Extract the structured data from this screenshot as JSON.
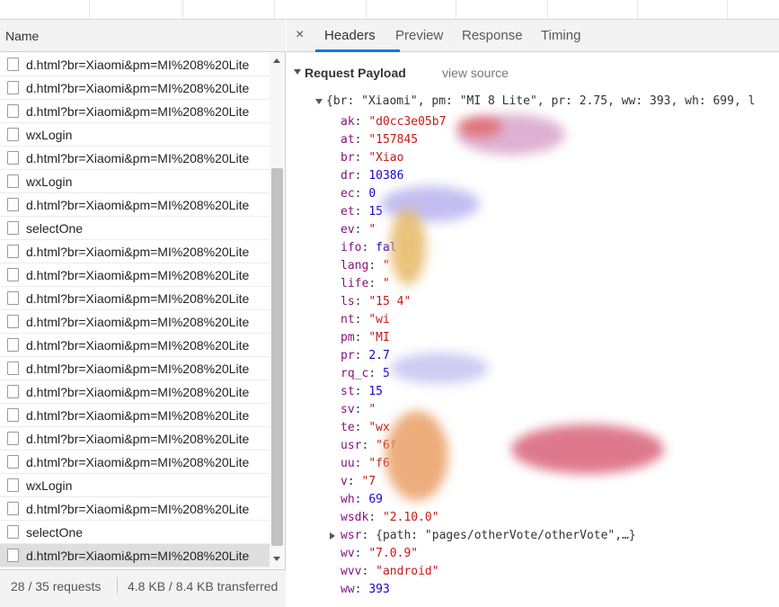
{
  "left_panel": {
    "column_header": "Name",
    "requests": [
      {
        "label": "d.html?br=Xiaomi&pm=MI%208%20Lite",
        "selected": false
      },
      {
        "label": "d.html?br=Xiaomi&pm=MI%208%20Lite",
        "selected": false
      },
      {
        "label": "d.html?br=Xiaomi&pm=MI%208%20Lite",
        "selected": false
      },
      {
        "label": "wxLogin",
        "selected": false
      },
      {
        "label": "d.html?br=Xiaomi&pm=MI%208%20Lite",
        "selected": false
      },
      {
        "label": "wxLogin",
        "selected": false
      },
      {
        "label": "d.html?br=Xiaomi&pm=MI%208%20Lite",
        "selected": false
      },
      {
        "label": "selectOne",
        "selected": false
      },
      {
        "label": "d.html?br=Xiaomi&pm=MI%208%20Lite",
        "selected": false
      },
      {
        "label": "d.html?br=Xiaomi&pm=MI%208%20Lite",
        "selected": false
      },
      {
        "label": "d.html?br=Xiaomi&pm=MI%208%20Lite",
        "selected": false
      },
      {
        "label": "d.html?br=Xiaomi&pm=MI%208%20Lite",
        "selected": false
      },
      {
        "label": "d.html?br=Xiaomi&pm=MI%208%20Lite",
        "selected": false
      },
      {
        "label": "d.html?br=Xiaomi&pm=MI%208%20Lite",
        "selected": false
      },
      {
        "label": "d.html?br=Xiaomi&pm=MI%208%20Lite",
        "selected": false
      },
      {
        "label": "d.html?br=Xiaomi&pm=MI%208%20Lite",
        "selected": false
      },
      {
        "label": "d.html?br=Xiaomi&pm=MI%208%20Lite",
        "selected": false
      },
      {
        "label": "d.html?br=Xiaomi&pm=MI%208%20Lite",
        "selected": false
      },
      {
        "label": "wxLogin",
        "selected": false
      },
      {
        "label": "d.html?br=Xiaomi&pm=MI%208%20Lite",
        "selected": false
      },
      {
        "label": "selectOne",
        "selected": false
      },
      {
        "label": "d.html?br=Xiaomi&pm=MI%208%20Lite",
        "selected": true
      }
    ],
    "status": {
      "requests": "28 / 35 requests",
      "transferred": "4.8 KB / 8.4 KB transferred"
    }
  },
  "right_panel": {
    "close_symbol": "×",
    "tabs": [
      {
        "label": "Headers",
        "active": true
      },
      {
        "label": "Preview",
        "active": false
      },
      {
        "label": "Response",
        "active": false
      },
      {
        "label": "Timing",
        "active": false
      }
    ],
    "section_title": "Request Payload",
    "view_source": "view source",
    "object_summary": "{br: \"Xiaomi\", pm: \"MI 8 Lite\", pr: 2.75, ww: 393, wh: 699, l",
    "properties": [
      {
        "key": "ak",
        "value": "\"d0cc3e05b7",
        "type": "str"
      },
      {
        "key": "at",
        "value": "\"157845",
        "type": "str"
      },
      {
        "key": "br",
        "value": "\"Xiao",
        "type": "str"
      },
      {
        "key": "dr",
        "value": "10386",
        "type": "num"
      },
      {
        "key": "ec",
        "value": "0",
        "type": "num"
      },
      {
        "key": "et",
        "value": "15",
        "type": "num"
      },
      {
        "key": "ev",
        "value": "\"",
        "type": "str"
      },
      {
        "key": "ifo",
        "value": "fal",
        "type": "num"
      },
      {
        "key": "lang",
        "value": "\"",
        "type": "str"
      },
      {
        "key": "life",
        "value": "\"",
        "type": "str"
      },
      {
        "key": "ls",
        "value": "\"15                   4\"",
        "type": "str"
      },
      {
        "key": "nt",
        "value": "\"wi",
        "type": "str"
      },
      {
        "key": "pm",
        "value": "\"MI",
        "type": "str"
      },
      {
        "key": "pr",
        "value": "2.7",
        "type": "num"
      },
      {
        "key": "rq_c",
        "value": "5",
        "type": "num"
      },
      {
        "key": "st",
        "value": "15",
        "type": "num"
      },
      {
        "key": "sv",
        "value": "\"",
        "type": "str"
      },
      {
        "key": "te",
        "value": "\"wx",
        "type": "str"
      },
      {
        "key": "usr",
        "value": "\"6f",
        "type": "str"
      },
      {
        "key": "uu",
        "value": "\"f6",
        "type": "str"
      },
      {
        "key": "v",
        "value": "\"7",
        "type": "str"
      },
      {
        "key": "wh",
        "value": "69",
        "type": "num"
      },
      {
        "key": "wsdk",
        "value": "\"2.10.0\"",
        "type": "str"
      },
      {
        "key": "wsr",
        "value": "{path: \"pages/otherVote/otherVote\",…}",
        "type": "obj"
      },
      {
        "key": "wv",
        "value": "\"7.0.9\"",
        "type": "str"
      },
      {
        "key": "wvv",
        "value": "\"android\"",
        "type": "str"
      },
      {
        "key": "ww",
        "value": "393",
        "type": "num"
      }
    ]
  },
  "colors": {
    "active_tab_underline": "#1a73e8",
    "key_color": "#881280",
    "string_color": "#c41a16",
    "number_color": "#1c00cf"
  }
}
